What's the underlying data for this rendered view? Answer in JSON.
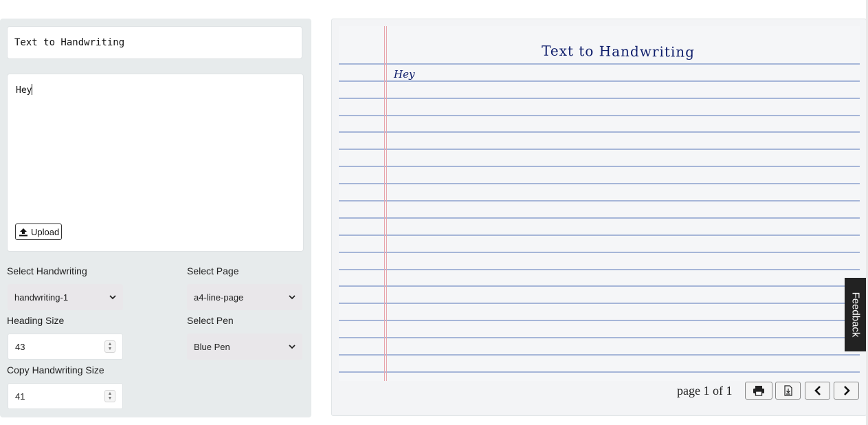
{
  "form": {
    "heading_value": "Text to Handwriting",
    "body_value": "Hey",
    "upload_label": "Upload",
    "handwriting": {
      "label": "Select Handwriting",
      "selected": "handwriting-1"
    },
    "page": {
      "label": "Select Page",
      "selected": "a4-line-page"
    },
    "heading_size": {
      "label": "Heading Size",
      "value": "43"
    },
    "pen": {
      "label": "Select Pen",
      "selected": "Blue Pen"
    },
    "copy_size": {
      "label": "Copy Handwriting Size",
      "value": "41"
    }
  },
  "preview": {
    "heading": "Text to Handwriting",
    "body": "Hey",
    "page_indicator": "page 1 of 1",
    "ink_color": "#0f1e6b",
    "rule_color": "#a6b6d8",
    "margin_color": "#e8a5ad"
  },
  "toolbar": {
    "print_icon": "printer-icon",
    "download_icon": "download-icon",
    "prev_icon": "chevron-left-icon",
    "next_icon": "chevron-right-icon"
  },
  "feedback": {
    "label": "Feedback"
  }
}
